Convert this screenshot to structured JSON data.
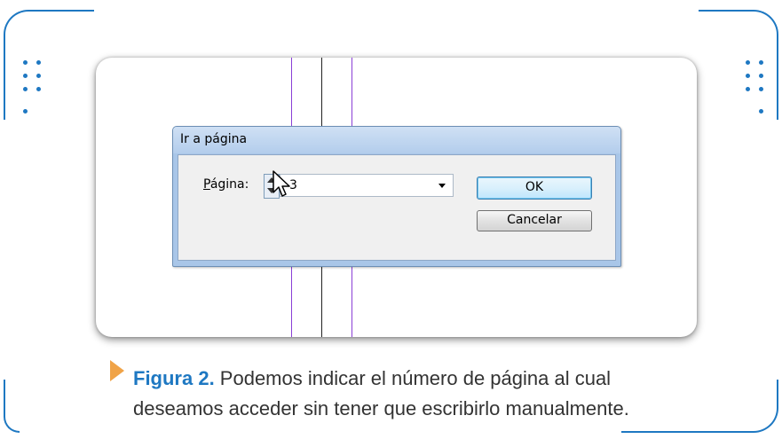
{
  "dialog": {
    "title": "Ir a página",
    "field_label_underlined": "P",
    "field_label_rest": "ágina:",
    "field_value": "3",
    "ok_label": "OK",
    "cancel_label": "Cancelar"
  },
  "caption": {
    "figure_label": "Figura 2.",
    "text": " Podemos indicar el número de página al cual deseamos acceder sin tener que escribirlo manualmente."
  },
  "colors": {
    "accent": "#1e78c2",
    "caption_arrow": "#f0a347",
    "guide_line_purple": "#8a3fd6",
    "guide_line_dark": "#222222"
  },
  "icons": {
    "spinner": "spinner-arrows-icon",
    "cursor": "mouse-pointer-icon",
    "dropdown": "chevron-down-icon",
    "caption_marker": "triangle-right-icon"
  }
}
